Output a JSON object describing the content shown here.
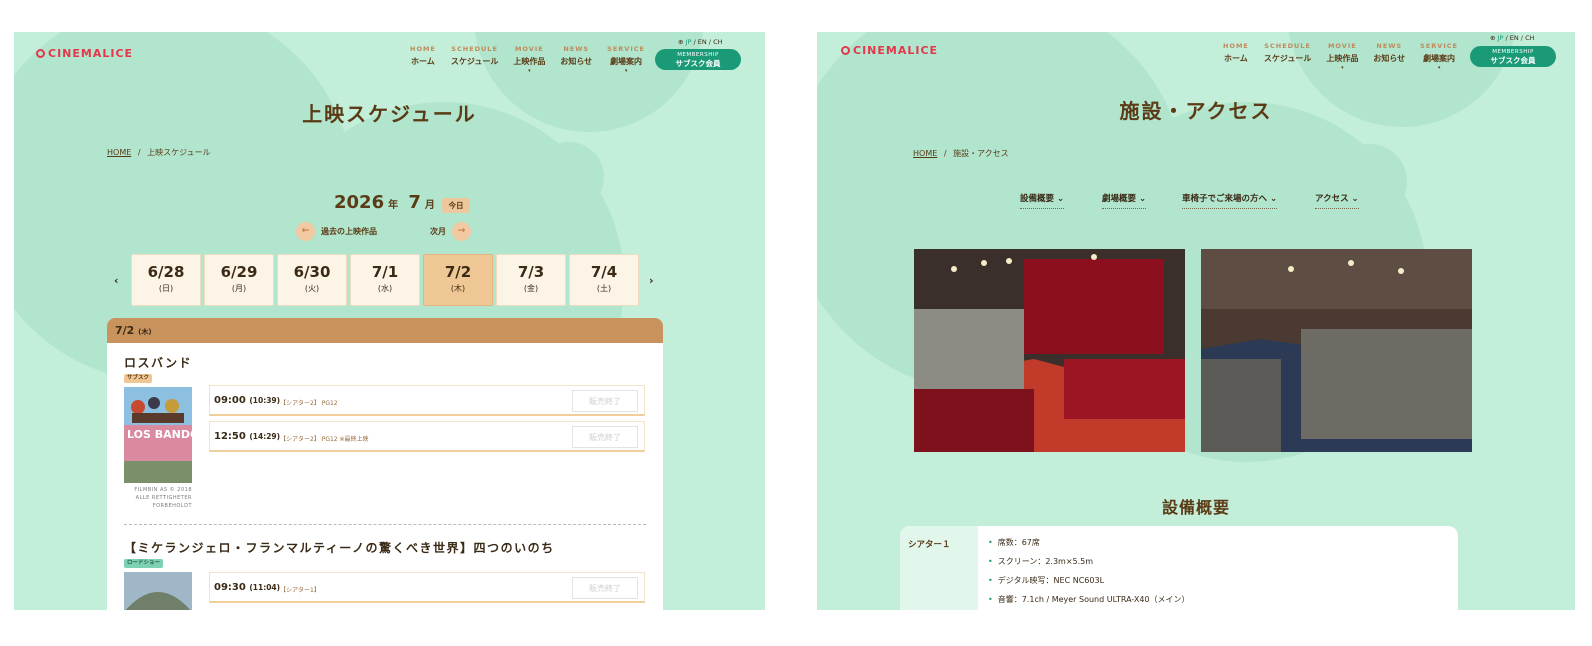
{
  "brand": {
    "name": "CINEMALICE"
  },
  "nav": [
    {
      "en": "HOME",
      "jp": "ホーム",
      "caret": ""
    },
    {
      "en": "SCHEDULE",
      "jp": "スケジュール",
      "caret": ""
    },
    {
      "en": "MOVIE",
      "jp": "上映作品",
      "caret": "▾"
    },
    {
      "en": "NEWS",
      "jp": "お知らせ",
      "caret": ""
    },
    {
      "en": "SERVICE",
      "jp": "劇場案内",
      "caret": "▾"
    }
  ],
  "lang": {
    "jp": "JP",
    "en": "EN",
    "ch": "CH",
    "sep": "/"
  },
  "membership": {
    "en": "MEMBERSHIP",
    "jp": "サブスク会員"
  },
  "schedule_page": {
    "title": "上映スケジュール",
    "breadcrumb": {
      "home": "HOME",
      "sep": "/",
      "current": "上映スケジュール"
    },
    "year": "2026",
    "year_unit": "年",
    "month": "7",
    "month_unit": "月",
    "today_label": "今日",
    "prev_label": "過去の上映作品",
    "next_label": "次月",
    "days": [
      {
        "date": "6/28",
        "weekday": "(日)"
      },
      {
        "date": "6/29",
        "weekday": "(月)"
      },
      {
        "date": "6/30",
        "weekday": "(火)"
      },
      {
        "date": "7/1",
        "weekday": "(水)"
      },
      {
        "date": "7/2",
        "weekday": "(木)"
      },
      {
        "date": "7/3",
        "weekday": "(金)"
      },
      {
        "date": "7/4",
        "weekday": "(土)"
      }
    ],
    "selected_date": "7/2",
    "selected_weekday": "(木)",
    "movies": [
      {
        "title": "ロスバンド",
        "badge": "サブスク",
        "poster_text": "LOS BANDO",
        "caption": [
          "FILMBIN AS © 2018",
          "ALLE RETTIGHETER",
          "FORBEHOLDT"
        ],
        "showings": [
          {
            "start": "09:00",
            "end": "(10:39)",
            "meta": "【シアター2】 PG12",
            "status": "販売終了"
          },
          {
            "start": "12:50",
            "end": "(14:29)",
            "meta": "【シアター2】 PG12 ※最終上映",
            "status": "販売終了"
          }
        ]
      },
      {
        "title": "【ミケランジェロ・フランマルティーノの驚くべき世界】四つのいのち",
        "badge": "ロードショー",
        "showings": [
          {
            "start": "09:30",
            "end": "(11:04)",
            "meta": "【シアター1】",
            "status": "販売終了"
          }
        ]
      }
    ]
  },
  "access_page": {
    "title": "施設・アクセス",
    "breadcrumb": {
      "home": "HOME",
      "sep": "/",
      "current": "施設・アクセス"
    },
    "tabs": [
      "設備概要",
      "劇場概要",
      "車椅子でご来場の方へ",
      "アクセス"
    ],
    "section_title": "設備概要",
    "theater": {
      "label": "シアター１",
      "specs": [
        "席数：67席",
        "スクリーン：2.3m×5.5m",
        "デジタル映写：NEC NC603L",
        "音響：7.1ch / Meyer Sound ULTRA-X40（メイン）"
      ]
    }
  },
  "colors": {
    "bg_mint": "#c3eed9",
    "deco_mint": "#b1e5cd",
    "accent_green": "#1a9a77",
    "brown": "#5b3b16",
    "logo_red": "#e4374a",
    "selected_day": "#efc794",
    "schedule_header": "#c9935e"
  },
  "icons": {
    "globe": "globe-icon",
    "prev": "arrow-left-icon",
    "next": "arrow-right-icon",
    "chevron": "chevron-down-icon",
    "logo": "cinemalice-logo-icon"
  }
}
